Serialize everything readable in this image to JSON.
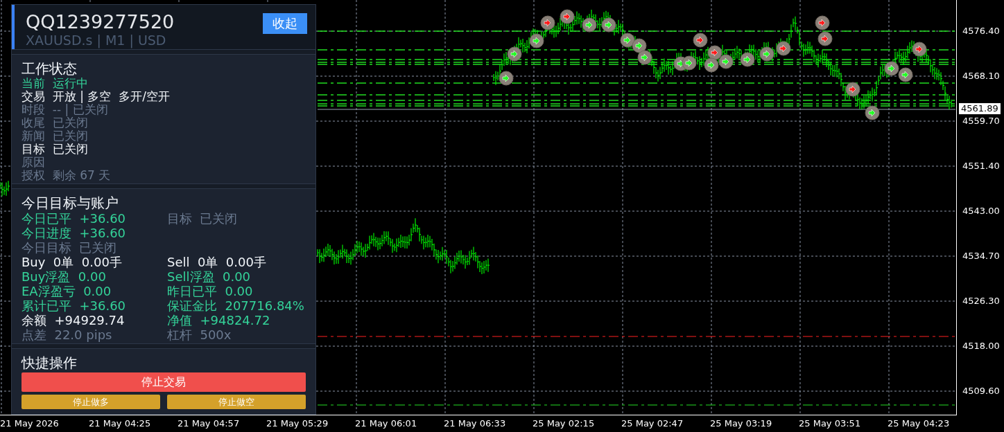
{
  "panel": {
    "title": "QQ1239277520",
    "subtitle": "XAUUSD.s | M1 | USD",
    "collapse_button": "收起",
    "status": {
      "heading": "工作状态",
      "rows": [
        {
          "label": "当前",
          "value": "运行中",
          "color": "#34d399"
        },
        {
          "label": "交易",
          "value": "开放 | 多空  多开/空开",
          "color": "#f1f5f9"
        },
        {
          "label": "时段",
          "value": "-- | 已关闭",
          "color": "#6b7a90"
        },
        {
          "label": "收尾",
          "value": "已关闭",
          "color": "#6b7a90"
        },
        {
          "label": "新闻",
          "value": "已关闭",
          "color": "#6b7a90"
        },
        {
          "label": "目标",
          "value": "已关闭",
          "color": "#f1f5f9"
        },
        {
          "label": "原因",
          "color": "#6b7a90"
        },
        {
          "label": "授权",
          "value": "剩余 67 天",
          "color": "#6b7a90"
        }
      ]
    },
    "account": {
      "heading": "今日目标与账户",
      "rows": [
        {
          "left": {
            "label": "今日已平",
            "value": "+36.60",
            "color": "#34d399"
          },
          "right": {
            "label": "目标",
            "value": "已关闭",
            "color": "#6b7a90"
          }
        },
        {
          "left": {
            "label": "今日进度",
            "value": "+36.60",
            "color": "#34d399"
          }
        },
        {
          "left": {
            "label": "今日目标",
            "value": "已关闭",
            "color": "#6b7a90"
          }
        },
        {
          "left": {
            "label": "Buy",
            "value": "0单  0.00手",
            "color": "#f1f5f9"
          },
          "right": {
            "label": "Sell",
            "value": "0单  0.00手",
            "color": "#f1f5f9"
          }
        },
        {
          "left": {
            "label": "Buy浮盈",
            "value": "0.00",
            "color": "#34d399"
          },
          "right": {
            "label": "Sell浮盈",
            "value": "0.00",
            "color": "#34d399"
          }
        },
        {
          "left": {
            "label": "EA浮盈亏",
            "value": "0.00",
            "color": "#34d399"
          },
          "right": {
            "label": "昨日已平",
            "value": "0.00",
            "color": "#34d399"
          }
        },
        {
          "left": {
            "label": "累计已平",
            "value": "+36.60",
            "color": "#34d399"
          },
          "right": {
            "label": "保证金比",
            "value": "207716.84%",
            "color": "#34d399"
          }
        },
        {
          "left": {
            "label": "余额",
            "value": "+94929.74",
            "color": "#f1f5f9"
          },
          "right": {
            "label": "净值",
            "value": "+94824.72",
            "color": "#34d399"
          }
        },
        {
          "left": {
            "label": "点差",
            "value": "22.0 pips",
            "color": "#6b7a90"
          },
          "right": {
            "label": "杠杆",
            "value": "500x",
            "color": "#6b7a90"
          }
        }
      ]
    },
    "actions": {
      "heading": "快捷操作",
      "buttons": [
        {
          "label": "停止交易",
          "kind": "danger"
        },
        {
          "label": "停止做多",
          "kind": "warning"
        },
        {
          "label": "停止做空",
          "kind": "warning"
        }
      ]
    }
  },
  "chart": {
    "price_labels": [
      "4576.40",
      "4568.10",
      "4559.70",
      "4551.40",
      "4543.00",
      "4534.70",
      "4526.30",
      "4518.00",
      "4509.60"
    ],
    "current_price": "4561.89",
    "time_labels": [
      "21 May 2026",
      "21 May 04:25",
      "21 May 04:57",
      "21 May 05:29",
      "21 May 06:01",
      "21 May 06:33",
      "25 May 02:15",
      "25 May 02:47",
      "25 May 03:19",
      "25 May 03:51",
      "25 May 04:23"
    ]
  }
}
